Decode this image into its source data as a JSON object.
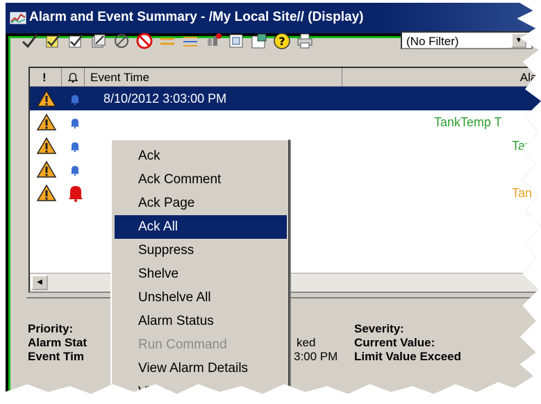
{
  "window": {
    "title": "Alarm and Event Summary - /My Local Site// (Display)"
  },
  "toolbar": {
    "icons": [
      "ack-icon",
      "ack-comment-icon",
      "ack-page-icon",
      "ack-all-icon",
      "suppress-icon",
      "shelve-icon",
      "unshelve-icon",
      "alarm-status-icon",
      "run-command-icon",
      "properties-icon",
      "help-icon",
      "print-icon"
    ],
    "filter_value": "(No Filter)"
  },
  "grid": {
    "headers": {
      "priority": "!",
      "state": "🔔",
      "event_time": "Event Time",
      "alarm": "Alar"
    },
    "rows": [
      {
        "event_time": "8/10/2012 3:03:00 PM",
        "tag": "",
        "color": "#ffffff"
      },
      {
        "event_time": "",
        "tag": "TankTemp T",
        "color": "#2e9e2e"
      },
      {
        "event_time": "",
        "tag": "Tan",
        "color": "#2e9e2e"
      },
      {
        "event_time": "",
        "tag": "",
        "color": "#2e9e2e"
      },
      {
        "event_time": "",
        "tag": "Tan",
        "color": "#e8a020"
      }
    ]
  },
  "details": {
    "priority_label": "Priority:",
    "alarm_state_label": "Alarm Stat",
    "event_time_label": "Event Tim",
    "severity_label": "Severity:",
    "current_value_label": "Current Value:",
    "limit_value_label": "Limit Value Exceed",
    "ack_state_value": "ked",
    "time_value": "3:00 PM"
  },
  "context_menu": {
    "items": [
      {
        "label": "Ack",
        "state": "normal"
      },
      {
        "label": "Ack Comment",
        "state": "normal"
      },
      {
        "label": "Ack Page",
        "state": "normal"
      },
      {
        "label": "Ack All",
        "state": "highlighted"
      },
      {
        "label": "Suppress",
        "state": "normal"
      },
      {
        "label": "Shelve",
        "state": "normal"
      },
      {
        "label": "Unshelve All",
        "state": "normal"
      },
      {
        "label": "Alarm Status",
        "state": "normal"
      },
      {
        "label": "Run Command",
        "state": "disabled"
      },
      {
        "label": "View Alarm Details",
        "state": "normal"
      },
      {
        "label": "View",
        "state": "normal"
      }
    ]
  },
  "colors": {
    "title_bar": "#0a246a",
    "selection": "#0a246a",
    "frame_border": "#14b814",
    "ok_text": "#2e9e2e",
    "warning_text": "#e8a020"
  }
}
